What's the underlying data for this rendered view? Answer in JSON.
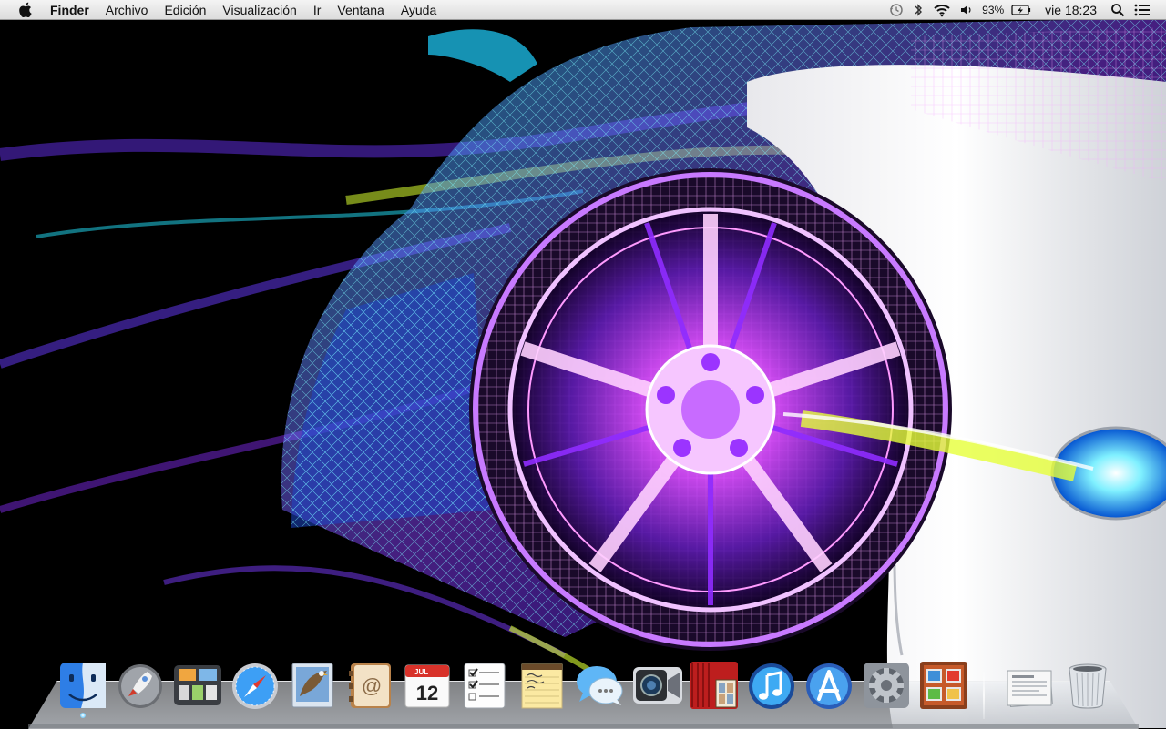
{
  "menubar": {
    "app_name": "Finder",
    "menus": [
      "Archivo",
      "Edición",
      "Visualización",
      "Ir",
      "Ventana",
      "Ayuda"
    ],
    "battery": "93%",
    "clock": "vie 18:23",
    "icons": [
      "apple-icon",
      "time-machine-icon",
      "bluetooth-icon",
      "wifi-icon",
      "volume-icon",
      "battery-icon",
      "spotlight-icon",
      "list-icon"
    ]
  },
  "desktop": {
    "wallpaper": "neon wireframe sports car wheel"
  },
  "dock": {
    "apps": [
      {
        "id": "finder",
        "name": "Finder",
        "icon": "finder-icon"
      },
      {
        "id": "launchpad",
        "name": "Launchpad",
        "icon": "launchpad-icon"
      },
      {
        "id": "mission-control",
        "name": "Mission Control",
        "icon": "mission-control-icon"
      },
      {
        "id": "safari",
        "name": "Safari",
        "icon": "safari-icon"
      },
      {
        "id": "mail",
        "name": "Mail",
        "icon": "mail-icon"
      },
      {
        "id": "contacts",
        "name": "Contactos",
        "icon": "contacts-icon"
      },
      {
        "id": "calendar",
        "name": "Calendario",
        "icon": "calendar-icon",
        "month": "JUL",
        "day": "12"
      },
      {
        "id": "reminders",
        "name": "Recordatorios",
        "icon": "reminders-icon"
      },
      {
        "id": "notes",
        "name": "Notas",
        "icon": "notes-icon"
      },
      {
        "id": "messages",
        "name": "Mensajes",
        "icon": "messages-icon"
      },
      {
        "id": "facetime",
        "name": "FaceTime",
        "icon": "facetime-icon"
      },
      {
        "id": "photo-booth",
        "name": "Photo Booth",
        "icon": "photo-booth-icon"
      },
      {
        "id": "itunes",
        "name": "iTunes",
        "icon": "itunes-icon"
      },
      {
        "id": "app-store",
        "name": "App Store",
        "icon": "app-store-icon"
      },
      {
        "id": "system-preferences",
        "name": "Preferencias del Sistema",
        "icon": "gear-icon"
      },
      {
        "id": "photo-app",
        "name": "Álbum",
        "icon": "photo-album-icon"
      }
    ],
    "right_items": [
      {
        "id": "documents",
        "name": "Documentos",
        "icon": "documents-stack-icon"
      },
      {
        "id": "trash",
        "name": "Papelera",
        "icon": "trash-icon"
      }
    ],
    "running": [
      "finder"
    ]
  },
  "colors": {
    "menubar": "#e8e8e8",
    "neon_purple": "#b040ff",
    "neon_cyan": "#20e0ff",
    "neon_yellow": "#d8ff30"
  }
}
